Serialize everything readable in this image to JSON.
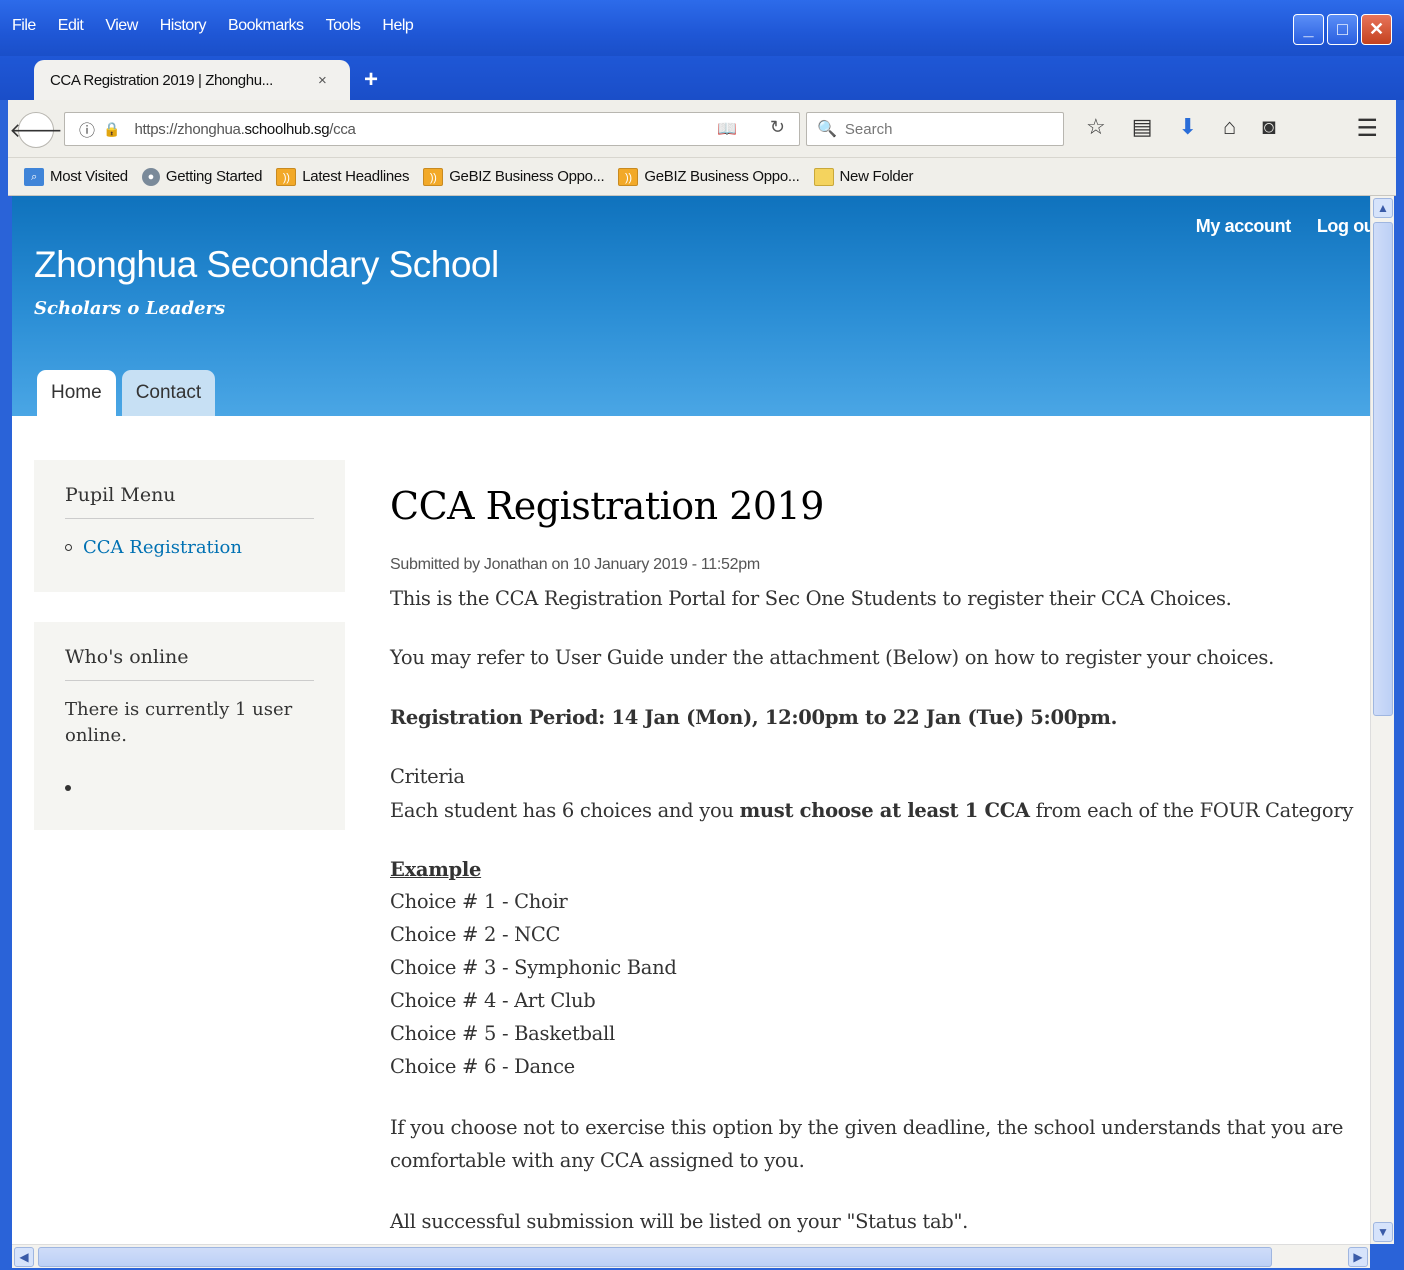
{
  "menubar": [
    "File",
    "Edit",
    "View",
    "History",
    "Bookmarks",
    "Tools",
    "Help"
  ],
  "tab": {
    "title": "CCA Registration 2019 | Zhonghu...",
    "close": "×",
    "new_tab": "+"
  },
  "nav": {
    "url_prefix": "https://zhonghua.",
    "url_domain": "schoolhub.sg",
    "url_path": "/cca",
    "search_placeholder": "Search"
  },
  "bookmarks": [
    "Most Visited",
    "Getting Started",
    "Latest Headlines",
    "GeBIZ Business Oppo...",
    "GeBIZ Business Oppo...",
    "New Folder"
  ],
  "site": {
    "secondary_menu": [
      "My account",
      "Log out"
    ],
    "name": "Zhonghua Secondary School",
    "slogan": "Scholars o Leaders",
    "tabs": [
      "Home",
      "Contact"
    ]
  },
  "sidebar": {
    "pupil_menu_title": "Pupil Menu",
    "pupil_menu_link": "CCA Registration",
    "online_title": "Who's online",
    "online_text": "There is currently 1 user online."
  },
  "article": {
    "title": "CCA Registration 2019",
    "submitted": "Submitted by Jonathan on 10 January 2019 - 11:52pm",
    "intro": "This is the CCA Registration Portal for Sec One Students to register their CCA Choices.",
    "guide": "You may refer to User Guide under the attachment (Below) on how to register your choices.",
    "period": "Registration Period: 14 Jan (Mon), 12:00pm to 22 Jan (Tue) 5:00pm.",
    "criteria_label": "Criteria",
    "criteria_pre": "Each student has 6 choices and you ",
    "criteria_bold": "must choose at least 1 CCA",
    "criteria_post": " from each of the FOUR Category",
    "example_label": "Example",
    "choices": [
      "Choice # 1 - Choir",
      "Choice # 2 - NCC",
      "Choice # 3 - Symphonic Band",
      "Choice # 4 - Art Club",
      "Choice # 5 - Basketball",
      "Choice # 6 - Dance"
    ],
    "deadline_1": "If you choose not to exercise this option by the given deadline, the school understands that you are",
    "deadline_2": "comfortable with any CCA assigned to you.",
    "status": "All successful submission will be listed on your \"Status tab\"."
  }
}
